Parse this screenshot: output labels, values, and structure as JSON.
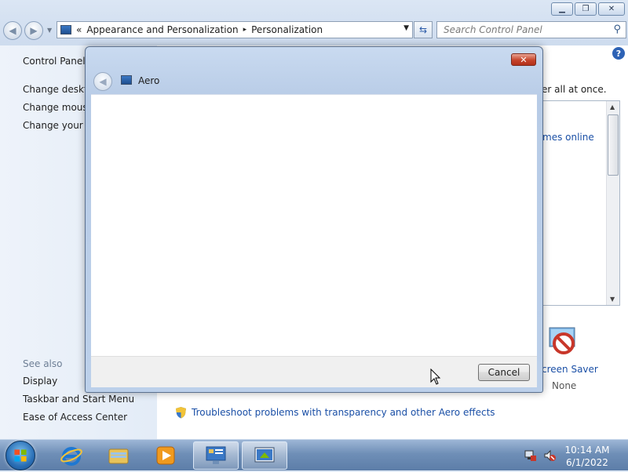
{
  "explorer": {
    "address": {
      "prefix": "«",
      "crumbs": [
        "Appearance and Personalization",
        "Personalization"
      ],
      "separator": "▸"
    },
    "search_placeholder": "Search Control Panel",
    "left_pane": {
      "home_link": "Control Panel H",
      "links": [
        "Change deskto",
        "Change mouse",
        "Change your a"
      ],
      "see_also_heading": "See also",
      "see_also_links": [
        "Display",
        "Taskbar and Start Menu",
        "Ease of Access Center"
      ]
    },
    "main": {
      "partial_heading": "er all at once.",
      "themes_online_link": "mes online",
      "screen_saver_label": "creen Saver",
      "screen_saver_value": "None",
      "troubleshoot_link": "Troubleshoot problems with transparency and other Aero effects"
    }
  },
  "dialog": {
    "title": "Aero",
    "cancel_label": "Cancel"
  },
  "taskbar": {
    "items": [
      "internet-explorer",
      "windows-explorer",
      "media-player",
      "control-panel",
      "aero-troubleshooter"
    ],
    "active_items": [
      "control-panel",
      "aero-troubleshooter"
    ],
    "clock_time": "10:14 AM",
    "clock_date": "6/1/2022"
  },
  "colors": {
    "link": "#1a4fa6",
    "dialog_close": "#c7442b",
    "taskbar": "#6f8fb7"
  }
}
